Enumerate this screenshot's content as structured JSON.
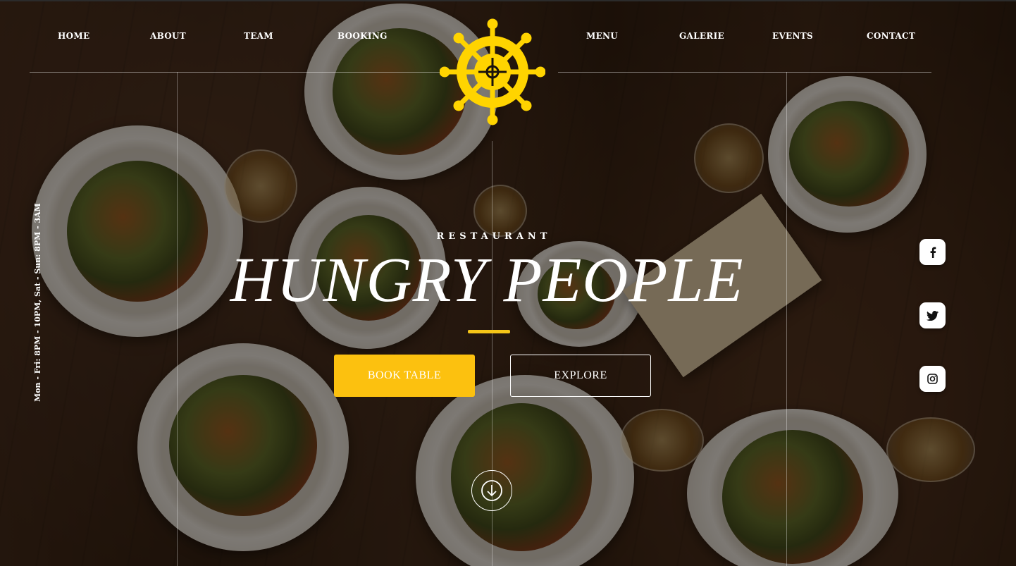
{
  "nav": {
    "left": [
      "HOME",
      "ABOUT",
      "TEAM",
      "BOOKING"
    ],
    "right": [
      "MENU",
      "GALERIE",
      "EVENTS",
      "CONTACT"
    ]
  },
  "logo": {
    "icon": "ship-wheel-icon",
    "color": "#ffd400"
  },
  "hero": {
    "subtitle": "RESTAURANT",
    "title": "HUNGRY PEOPLE",
    "primary_button": "BOOK TABLE",
    "secondary_button": "EXPLORE",
    "scroll_icon": "arrow-down-circle-icon"
  },
  "hours": "Mon - Fri: 8PM - 10PM, Sat - Sun: 8PM - 3AM",
  "social": [
    {
      "name": "facebook",
      "icon": "facebook-icon"
    },
    {
      "name": "twitter",
      "icon": "twitter-icon"
    },
    {
      "name": "instagram",
      "icon": "instagram-icon"
    }
  ],
  "colors": {
    "accent": "#fcc10f",
    "text": "#ffffff"
  }
}
